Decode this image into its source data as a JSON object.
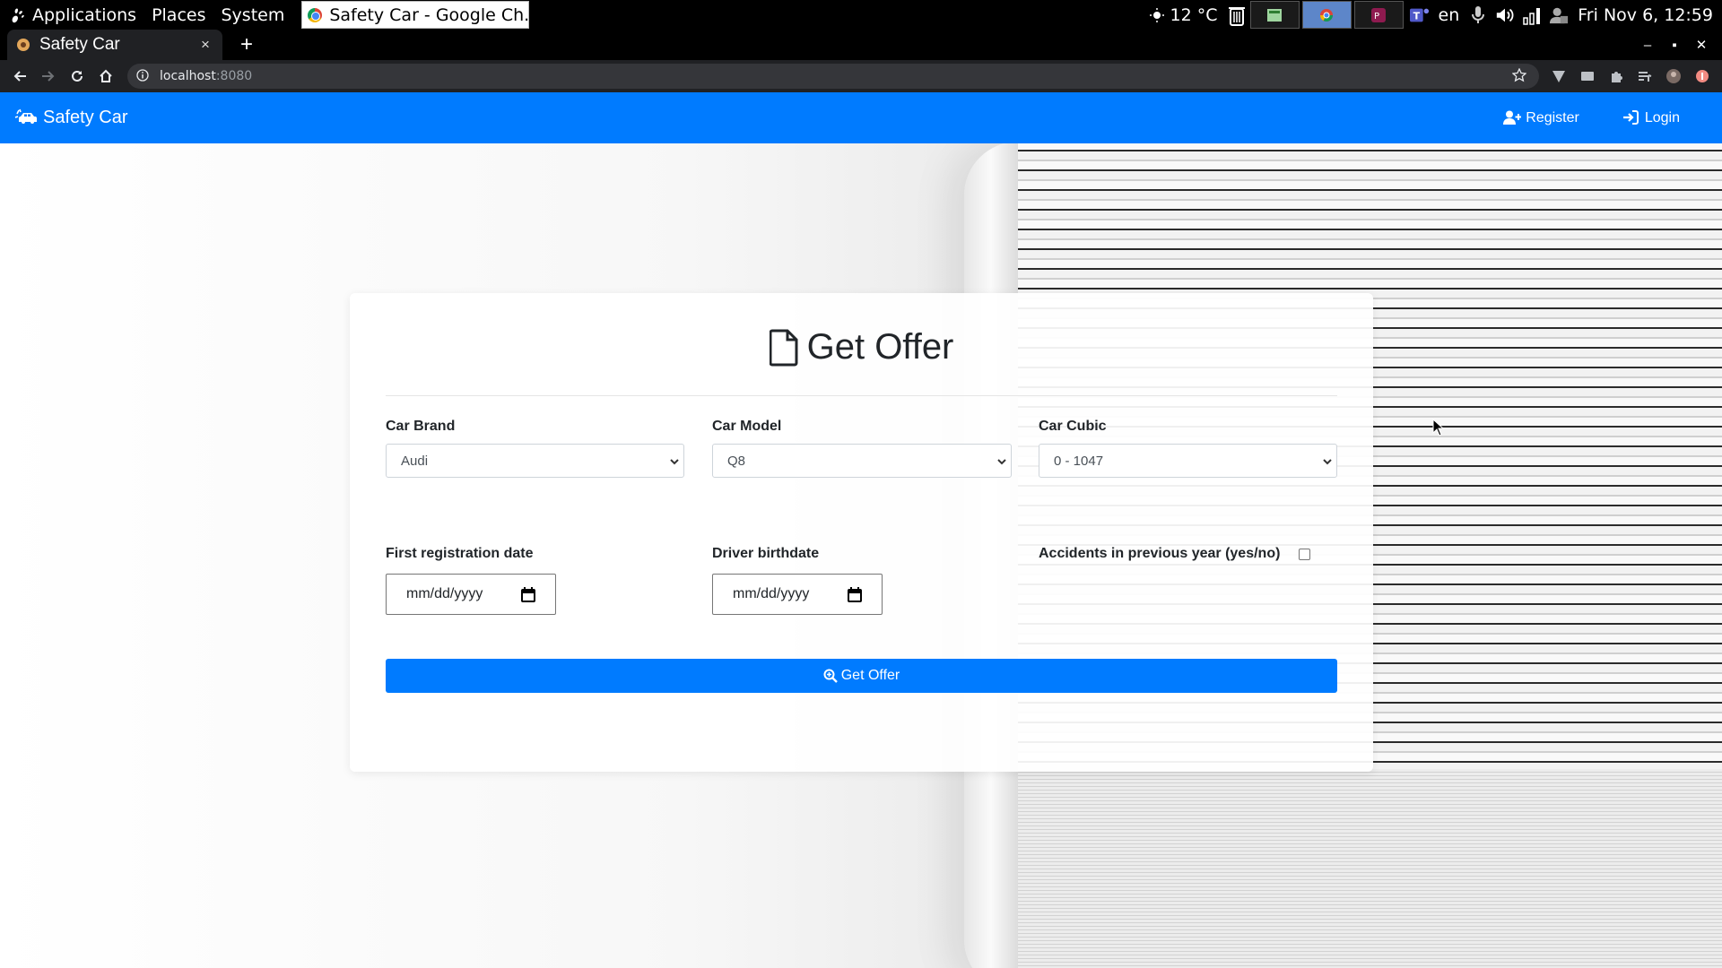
{
  "os_panel": {
    "menus": [
      "Applications",
      "Places",
      "System"
    ],
    "task_title": "Safety Car - Google Ch...",
    "weather": "12 °C",
    "language": "en",
    "clock": "Fri Nov  6, 12:59"
  },
  "browser": {
    "tab_title": "Safety Car",
    "tab_close": "×",
    "new_tab": "+",
    "url_host": "localhost",
    "url_port": ":8080"
  },
  "navbar": {
    "brand": "Safety Car",
    "register": "Register",
    "login": "Login"
  },
  "form": {
    "title": "Get Offer",
    "car_brand": {
      "label": "Car Brand",
      "value": "Audi"
    },
    "car_model": {
      "label": "Car Model",
      "value": "Q8"
    },
    "car_cubic": {
      "label": "Car Cubic",
      "value": "0 - 1047"
    },
    "first_registration": {
      "label": "First registration date",
      "value": "mm/dd/yyyy"
    },
    "driver_birthdate": {
      "label": "Driver birthdate",
      "value": "mm/dd/yyyy"
    },
    "accidents": {
      "label": "Accidents in previous year (yes/no)",
      "checked": false
    },
    "submit_label": "Get Offer"
  },
  "colors": {
    "primary": "#007bff",
    "panel": "#000000",
    "browser_chrome": "#202124"
  }
}
